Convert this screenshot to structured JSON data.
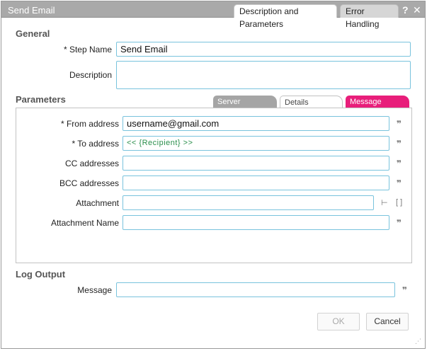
{
  "window": {
    "title": "Send Email",
    "tabs": [
      "Description and Parameters",
      "Error Handling"
    ],
    "help_icon": "?",
    "close_icon": "✕"
  },
  "general": {
    "heading": "General",
    "step_name_label": "* Step Name",
    "step_name_value": "Send Email",
    "description_label": "Description",
    "description_value": ""
  },
  "parameters": {
    "heading": "Parameters",
    "tabs": [
      "Server",
      "Details",
      "Message"
    ],
    "active_tab": "Details",
    "fields": [
      {
        "label": "* From address",
        "value": "username@gmail.com"
      },
      {
        "label": "* To address",
        "value": "<< {Recipient} >>"
      },
      {
        "label": "CC addresses",
        "value": ""
      },
      {
        "label": "BCC addresses",
        "value": ""
      },
      {
        "label": "Attachment",
        "value": ""
      },
      {
        "label": "Attachment Name",
        "value": ""
      }
    ]
  },
  "log_output": {
    "heading": "Log Output",
    "message_label": "Message",
    "message_value": ""
  },
  "buttons": {
    "ok": "OK",
    "cancel": "Cancel"
  },
  "icons": {
    "quote": "❞",
    "tree": "⊢",
    "brackets": "[ ]",
    "grip": "⋰"
  },
  "colors": {
    "titlebar": "#a9a9a9",
    "field_border": "#79c3dd",
    "message_tab": "#e81e7a",
    "variable_text": "#2a8f4c"
  }
}
